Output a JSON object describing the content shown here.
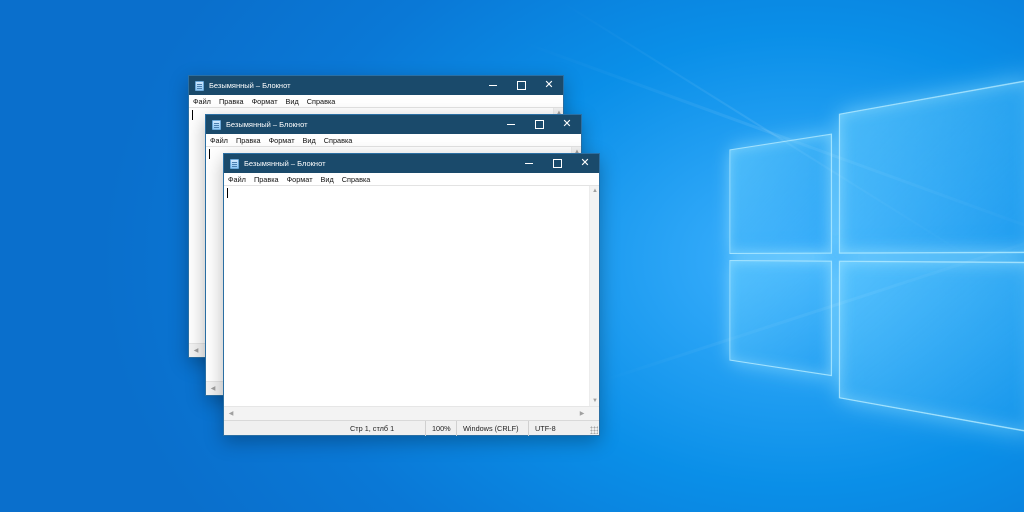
{
  "windows": [
    {
      "title": "Безымянный – Блокнот",
      "menu": [
        "Файл",
        "Правка",
        "Формат",
        "Вид",
        "Справка"
      ]
    },
    {
      "title": "Безымянный – Блокнот",
      "menu": [
        "Файл",
        "Правка",
        "Формат",
        "Вид",
        "Справка"
      ]
    },
    {
      "title": "Безымянный – Блокнот",
      "menu": [
        "Файл",
        "Правка",
        "Формат",
        "Вид",
        "Справка"
      ],
      "status": {
        "position": "Стр 1, стлб 1",
        "zoom": "100%",
        "line_endings": "Windows (CRLF)",
        "encoding": "UTF-8"
      }
    }
  ],
  "icons": {
    "window_controls": [
      "minimize-icon",
      "maximize-icon",
      "close-icon"
    ],
    "app": "notepad-icon",
    "desktop_logo": "windows-logo"
  },
  "colors": {
    "desktop": "#0a8fe8",
    "titlebar": "#1a4a6b",
    "window_border": "#2b6fa3"
  }
}
